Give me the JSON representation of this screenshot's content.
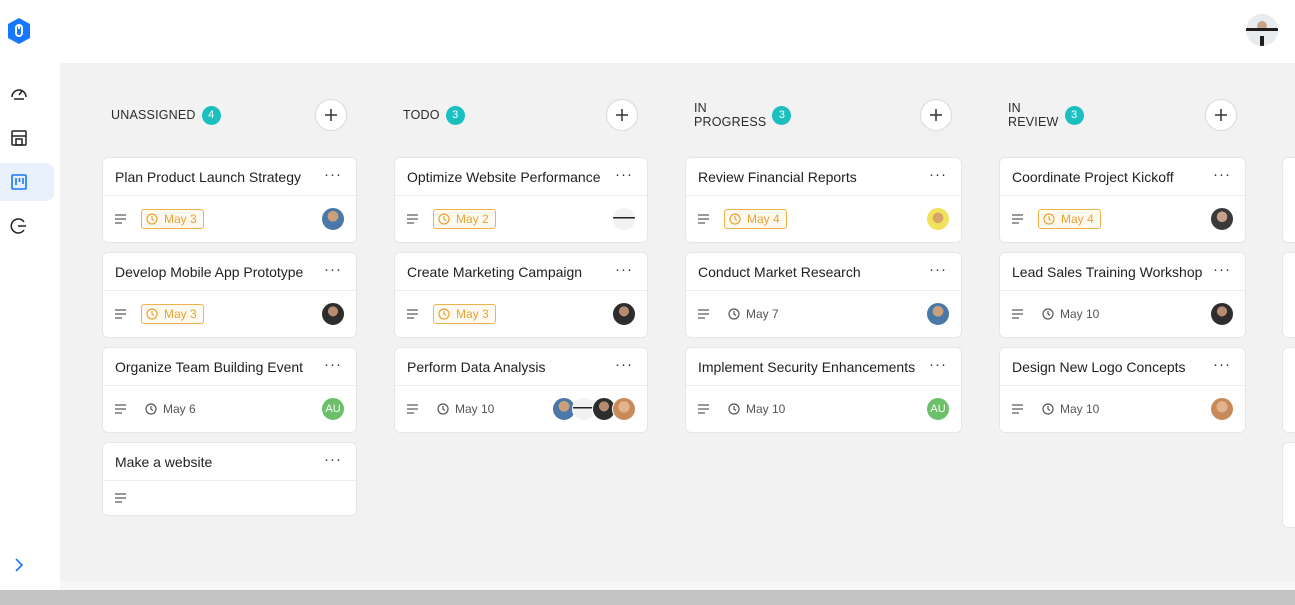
{
  "sidebar": {
    "logo_icon": "shield-logo",
    "items": [
      {
        "name": "dashboard",
        "icon": "gauge-icon",
        "active": false
      },
      {
        "name": "store",
        "icon": "store-icon",
        "active": false
      },
      {
        "name": "kanban",
        "icon": "kanban-icon",
        "active": true
      },
      {
        "name": "logout",
        "icon": "logout-icon",
        "active": false
      }
    ],
    "expand_icon": "chevron-right-icon"
  },
  "header": {
    "user_avatar": "user-avatar"
  },
  "colors": {
    "accent": "#1677ff",
    "badge": "#1bbfc0",
    "due": "#e8a235",
    "board_bg": "#f2f2f2"
  },
  "columns": [
    {
      "title": "UNASSIGNED",
      "count": "4",
      "cards": [
        {
          "title": "Plan Product Launch Strategy",
          "date": "May 3",
          "due": true,
          "avatars": [
            "p1"
          ]
        },
        {
          "title": "Develop Mobile App Prototype",
          "date": "May 3",
          "due": true,
          "avatars": [
            "p2"
          ]
        },
        {
          "title": "Organize Team Building Event",
          "date": "May 6",
          "due": false,
          "avatars": [
            "AU"
          ]
        },
        {
          "title": "Make a website",
          "date": "",
          "due": false,
          "avatars": []
        }
      ]
    },
    {
      "title": "TODO",
      "count": "3",
      "cards": [
        {
          "title": "Optimize Website Performance",
          "date": "May 2",
          "due": true,
          "avatars": [
            "p3"
          ]
        },
        {
          "title": "Create Marketing Campaign",
          "date": "May 3",
          "due": true,
          "avatars": [
            "p2"
          ]
        },
        {
          "title": "Perform Data Analysis",
          "date": "May 10",
          "due": false,
          "avatars": [
            "p1",
            "p3",
            "p2",
            "p5"
          ]
        }
      ]
    },
    {
      "title": "IN PROGRESS",
      "count": "3",
      "cards": [
        {
          "title": "Review Financial Reports",
          "date": "May 4",
          "due": true,
          "avatars": [
            "p4"
          ]
        },
        {
          "title": "Conduct Market Research",
          "date": "May 7",
          "due": false,
          "avatars": [
            "p1"
          ]
        },
        {
          "title": "Implement Security Enhancements",
          "date": "May 10",
          "due": false,
          "avatars": [
            "AU"
          ]
        }
      ]
    },
    {
      "title": "IN REVIEW",
      "count": "3",
      "cards": [
        {
          "title": "Coordinate Project Kickoff",
          "date": "May 4",
          "due": true,
          "avatars": [
            "p6"
          ]
        },
        {
          "title": "Lead Sales Training Workshop",
          "date": "May 10",
          "due": false,
          "avatars": [
            "p2"
          ]
        },
        {
          "title": "Design New Logo Concepts",
          "date": "May 10",
          "due": false,
          "avatars": [
            "p5"
          ]
        }
      ]
    }
  ]
}
